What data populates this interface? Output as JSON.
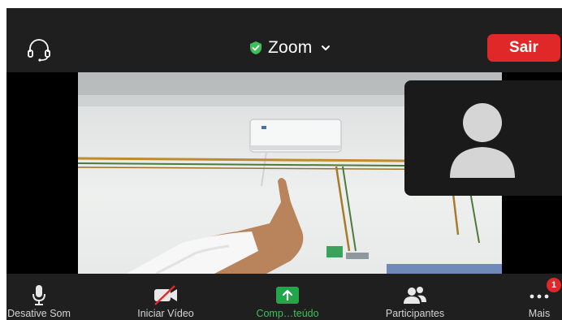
{
  "header": {
    "title": "Zoom",
    "leave_label": "Sair",
    "icons": [
      "headset-icon",
      "shield-check-icon",
      "chevron-down-icon"
    ]
  },
  "toolbar": {
    "items": [
      {
        "label": "Desative Som",
        "icon": "microphone-icon"
      },
      {
        "label": "Iniciar Vídeo",
        "icon": "video-off-icon"
      },
      {
        "label": "Comp…teúdo",
        "icon": "share-screen-icon"
      },
      {
        "label": "Participantes",
        "icon": "participants-icon"
      },
      {
        "label": "Mais",
        "icon": "more-icon"
      }
    ],
    "more_badge": "1"
  },
  "colors": {
    "bar_bg": "#1f1f1f",
    "leave_red": "#e02828",
    "shield_green": "#3fbf5a",
    "share_green": "#23a54a"
  }
}
